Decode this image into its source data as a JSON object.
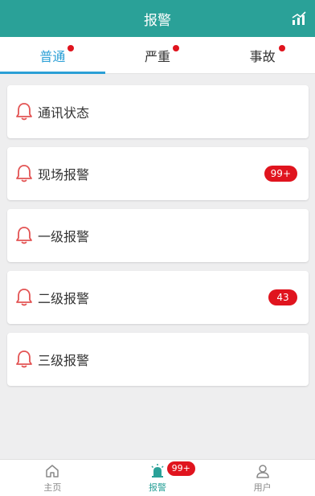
{
  "header": {
    "title": "报警",
    "icon": "chart-icon"
  },
  "tabs": [
    {
      "label": "普通",
      "active": true,
      "dot": true
    },
    {
      "label": "严重",
      "active": false,
      "dot": true
    },
    {
      "label": "事故",
      "active": false,
      "dot": true
    }
  ],
  "alarms": [
    {
      "label": "通讯状态",
      "badge": ""
    },
    {
      "label": "现场报警",
      "badge": "99+"
    },
    {
      "label": "一级报警",
      "badge": ""
    },
    {
      "label": "二级报警",
      "badge": "43"
    },
    {
      "label": "三级报警",
      "badge": ""
    }
  ],
  "bottom_nav": [
    {
      "label": "主页",
      "icon": "home-icon"
    },
    {
      "label": "报警",
      "icon": "alarm-light-icon",
      "badge": "99+",
      "active": true
    },
    {
      "label": "用户",
      "icon": "user-icon"
    }
  ],
  "colors": {
    "accent": "#2aa198",
    "tab_active": "#2a9fd6",
    "badge": "#e0141e",
    "bell": "#e35454"
  }
}
